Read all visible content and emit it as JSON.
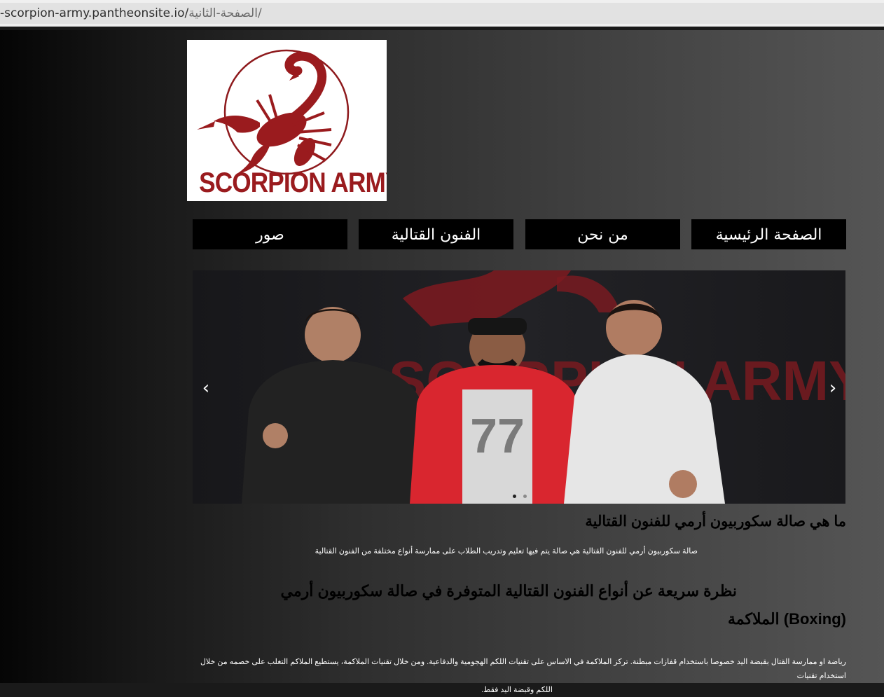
{
  "browser": {
    "url_host": "-scorpion-army.pantheonsite.io/",
    "url_path": "الصفحة-الثانية/"
  },
  "logo": {
    "text": "SCORPION ARMY"
  },
  "nav": {
    "items": [
      {
        "label": "الصفحة الرئيسية"
      },
      {
        "label": "من نحن"
      },
      {
        "label": "الفنون القتالية"
      },
      {
        "label": "صور"
      }
    ]
  },
  "slider": {
    "prev_icon": "chevron-left-icon",
    "next_icon": "chevron-right-icon",
    "prev_glyph": "‹",
    "next_glyph": "›",
    "backdrop_text": "SCORPION ARMY",
    "shirt_number": "77",
    "active_slide": 1,
    "slide_count": 2
  },
  "content": {
    "heading1": "ما هي صالة سكوربيون أرمي للفنون القتالية",
    "paragraph1": "صالة سكوربيون أرمي للفنون القتالية هي صالة يتم فيها تعليم وتدريب الطلاب على ممارسة أنواع مختلفة من الفنون القتالية",
    "heading2": "نظرة سريعة عن أنواع الفنون القتالية المتوفرة في صالة سكوربيون أرمي",
    "heading3": "(Boxing) الملاكمة",
    "paragraph2_line1": "رياضة او ممارسة القتال بقبضة اليد خصوصا باستخدام قفازات مبطنة. تركز الملاكمة في الاساس على تقنيات اللكم الهجومية والدفاعية. ومن خلال تقنيات الملاكمة، يستطيع الملاكم التغلب على خصمه من خلال استخدام تقنيات",
    "paragraph2_line2": "اللكم وقبضة اليد فقط."
  },
  "colors": {
    "brand_red": "#9a1b1e",
    "nav_bg": "#000000",
    "nav_text": "#ffffff"
  }
}
